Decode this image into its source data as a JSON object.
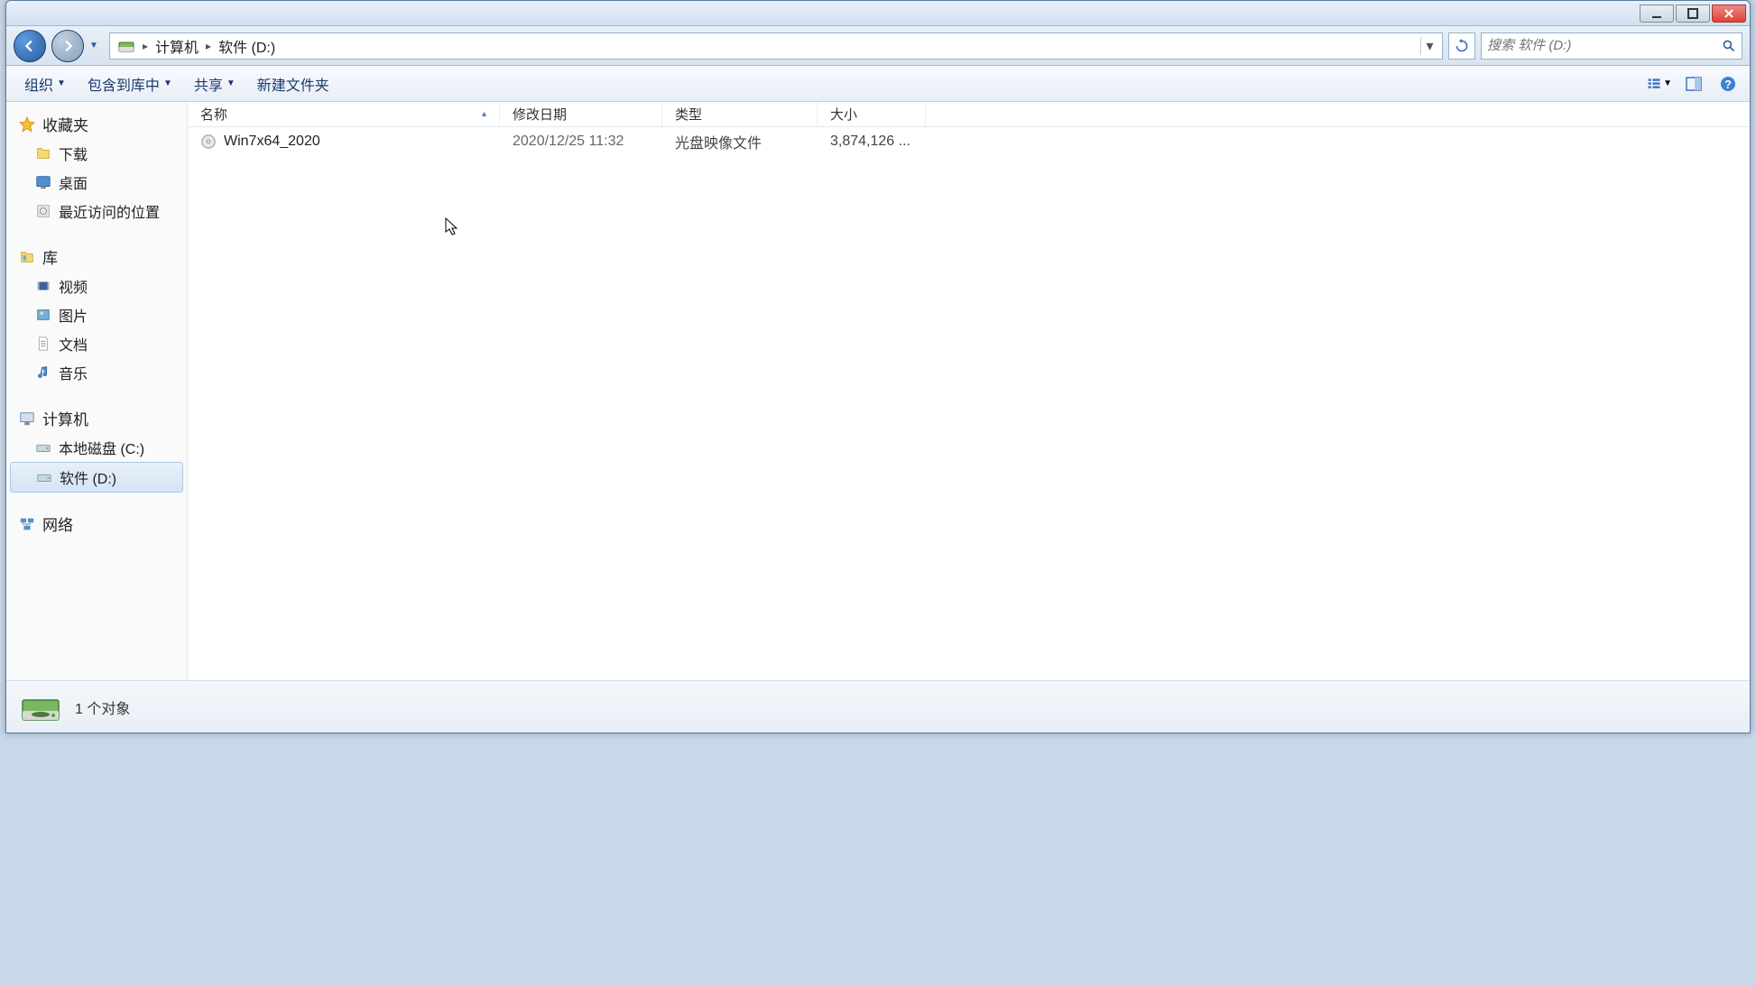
{
  "breadcrumb": {
    "items": [
      "计算机",
      "软件 (D:)"
    ]
  },
  "search": {
    "placeholder": "搜索 软件 (D:)"
  },
  "toolbar": {
    "organize": "组织",
    "include": "包含到库中",
    "share": "共享",
    "newfolder": "新建文件夹"
  },
  "columns": {
    "name": "名称",
    "date": "修改日期",
    "type": "类型",
    "size": "大小"
  },
  "sidebar": {
    "favorites": {
      "header": "收藏夹",
      "items": [
        "下载",
        "桌面",
        "最近访问的位置"
      ]
    },
    "libraries": {
      "header": "库",
      "items": [
        "视频",
        "图片",
        "文档",
        "音乐"
      ]
    },
    "computer": {
      "header": "计算机",
      "items": [
        "本地磁盘 (C:)",
        "软件 (D:)"
      ]
    },
    "network": {
      "header": "网络"
    }
  },
  "files": [
    {
      "name": "Win7x64_2020",
      "date": "2020/12/25 11:32",
      "type": "光盘映像文件",
      "size": "3,874,126 ..."
    }
  ],
  "status": {
    "text": "1 个对象"
  }
}
